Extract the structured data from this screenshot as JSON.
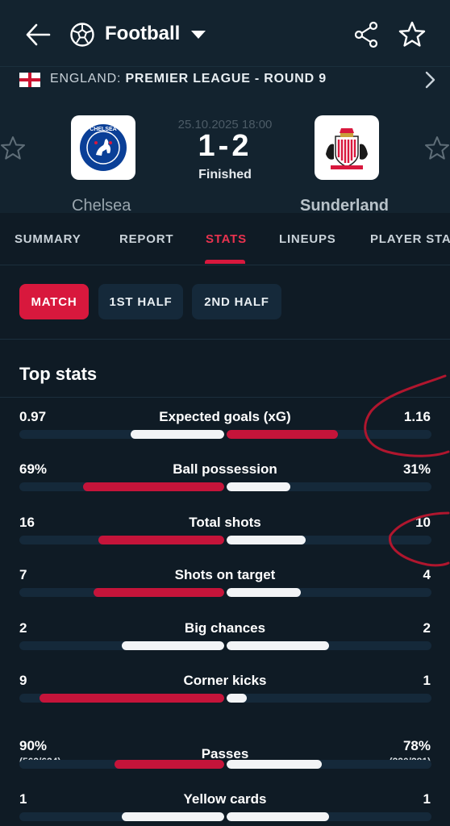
{
  "header": {
    "sport_title": "Football",
    "back_icon": "arrow-left-icon",
    "sport_icon": "soccer-ball-icon",
    "share_icon": "share-icon",
    "favorite_icon": "star-icon"
  },
  "league": {
    "country": "ENGLAND:",
    "competition": "PREMIER LEAGUE - ROUND 9"
  },
  "match": {
    "datetime": "25.10.2025 18:00",
    "score": "1-2",
    "status": "Finished",
    "home_team": "Chelsea",
    "away_team": "Sunderland"
  },
  "tabs": [
    {
      "label": "SUMMARY"
    },
    {
      "label": "REPORT"
    },
    {
      "label": "STATS"
    },
    {
      "label": "LINEUPS"
    },
    {
      "label": "PLAYER STA"
    }
  ],
  "active_tab": "STATS",
  "periods": [
    {
      "label": "MATCH"
    },
    {
      "label": "1ST HALF"
    },
    {
      "label": "2ND HALF"
    }
  ],
  "active_period": "MATCH",
  "section_title": "Top stats",
  "stats": [
    {
      "name": "Expected goals (xG)",
      "home": "0.97",
      "away": "1.16",
      "home_share": 0.455,
      "away_share": 0.545,
      "winner": "away"
    },
    {
      "name": "Ball possession",
      "home": "69%",
      "away": "31%",
      "home_share": 0.69,
      "away_share": 0.31,
      "winner": "home"
    },
    {
      "name": "Total shots",
      "home": "16",
      "away": "10",
      "home_share": 0.615,
      "away_share": 0.385,
      "winner": "home"
    },
    {
      "name": "Shots on target",
      "home": "7",
      "away": "4",
      "home_share": 0.636,
      "away_share": 0.364,
      "winner": "home"
    },
    {
      "name": "Big chances",
      "home": "2",
      "away": "2",
      "home_share": 0.5,
      "away_share": 0.5,
      "winner": "none"
    },
    {
      "name": "Corner kicks",
      "home": "9",
      "away": "1",
      "home_share": 0.9,
      "away_share": 0.1,
      "winner": "home"
    },
    {
      "name": "Passes",
      "home": "90%",
      "away": "78%",
      "home_sub": "(563/624)",
      "away_sub": "(220/281)",
      "home_share": 0.536,
      "away_share": 0.464,
      "winner": "home"
    },
    {
      "name": "Yellow cards",
      "home": "1",
      "away": "1",
      "home_share": 0.5,
      "away_share": 0.5,
      "winner": "none"
    }
  ],
  "colors": {
    "accent": "#d8183d",
    "background": "#0f1b25",
    "header": "#13232f",
    "track": "#15293a"
  }
}
